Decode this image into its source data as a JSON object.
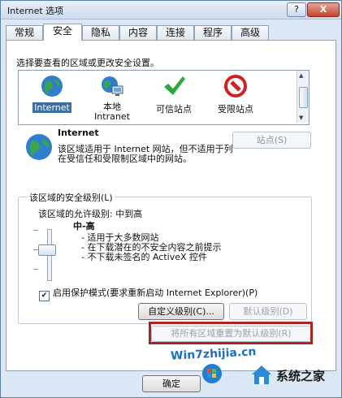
{
  "window": {
    "title": "Internet 选项",
    "help_label": "?",
    "close_label": "X"
  },
  "tabs": [
    {
      "label": "常规"
    },
    {
      "label": "安全"
    },
    {
      "label": "隐私"
    },
    {
      "label": "内容"
    },
    {
      "label": "连接"
    },
    {
      "label": "程序"
    },
    {
      "label": "高级"
    }
  ],
  "active_tab": "安全",
  "security": {
    "caption": "选择要查看的区域或更改安全设置。",
    "zones": [
      {
        "label": "Internet",
        "icon": "globe-icon",
        "selected": true
      },
      {
        "label": "本地\nIntranet",
        "icon": "intranet-icon"
      },
      {
        "label": "可信站点",
        "icon": "checkmark-icon"
      },
      {
        "label": "受限站点",
        "icon": "prohibited-icon"
      }
    ],
    "zone_info": {
      "title": "Internet",
      "description": "该区域适用于 Internet 网站，但不适用于列在受信任和受限制区域中的网站。",
      "sites_button": "站点(S)"
    },
    "level_group": {
      "legend": "该区域的安全级别(L)",
      "allowed": "该区域的允许级别: 中到高",
      "level_name": "中-高",
      "level_desc": [
        "- 适用于大多数网站",
        "- 在下载潜在的不安全内容之前提示",
        "- 不下载未签名的 ActiveX 控件"
      ],
      "protected_mode": "启用保护模式(要求重新启动 Internet Explorer)(P)",
      "protected_checked": true,
      "custom_button": "自定义级别(C)...",
      "default_button": "默认级别(D)"
    },
    "reset_all_button": "将所有区域重置为默认级别(R)"
  },
  "footer": {
    "ok_button": "确定"
  },
  "watermark": {
    "left": "Win7zhijia.cn",
    "right": "系统之家"
  },
  "colors": {
    "highlight": "#b22222",
    "selection": "#3a6ea5"
  }
}
